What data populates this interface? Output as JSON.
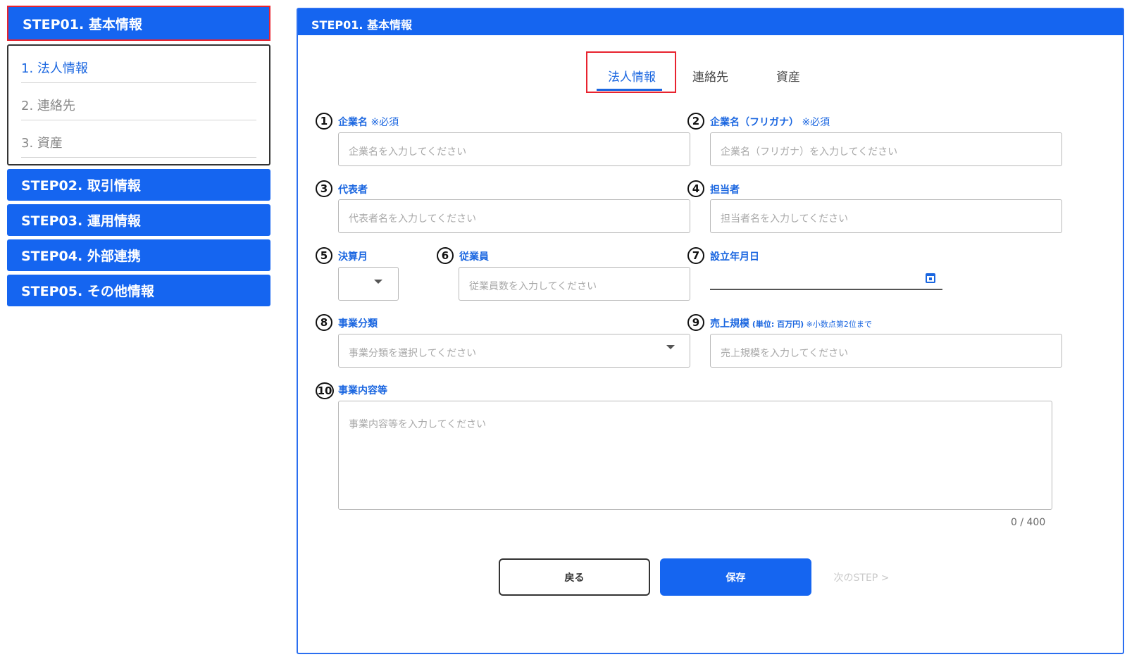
{
  "sidebar": {
    "steps": [
      {
        "label": "STEP01. 基本情報"
      },
      {
        "label": "STEP02. 取引情報"
      },
      {
        "label": "STEP03. 運用情報"
      },
      {
        "label": "STEP04. 外部連携"
      },
      {
        "label": "STEP05. その他情報"
      }
    ],
    "substeps": [
      {
        "label": "1. 法人情報"
      },
      {
        "label": "2. 連絡先"
      },
      {
        "label": "3. 資産"
      }
    ]
  },
  "card": {
    "title": "STEP01. 基本情報"
  },
  "tabs": [
    {
      "label": "法人情報"
    },
    {
      "label": "連絡先"
    },
    {
      "label": "資産"
    }
  ],
  "fields": {
    "company_name": {
      "num": "1",
      "label": "企業名",
      "req": " ※必須",
      "placeholder": "企業名を入力してください"
    },
    "company_kana": {
      "num": "2",
      "label": "企業名（フリガナ）",
      "req": " ※必須",
      "placeholder": "企業名（フリガナ）を入力してください"
    },
    "representative": {
      "num": "3",
      "label": "代表者",
      "placeholder": "代表者名を入力してください"
    },
    "contact_person": {
      "num": "4",
      "label": "担当者",
      "placeholder": "担当者名を入力してください"
    },
    "fiscal_month": {
      "num": "5",
      "label": "決算月"
    },
    "employees": {
      "num": "6",
      "label": "従業員",
      "placeholder": "従業員数を入力してください"
    },
    "established": {
      "num": "7",
      "label": "設立年月日"
    },
    "business_category": {
      "num": "8",
      "label": "事業分類",
      "placeholder": "事業分類を選択してください"
    },
    "sales_scale": {
      "num": "9",
      "label": "売上規模",
      "unit": " (単位: 百万円)",
      "note": " ※小数点第2位まで",
      "placeholder": "売上規模を入力してください"
    },
    "business_content": {
      "num": "10",
      "label": "事業内容等",
      "placeholder": "事業内容等を入力してください",
      "counter": "0 / 400"
    }
  },
  "buttons": {
    "back": "戻る",
    "save": "保存",
    "next": "次のSTEP >"
  }
}
